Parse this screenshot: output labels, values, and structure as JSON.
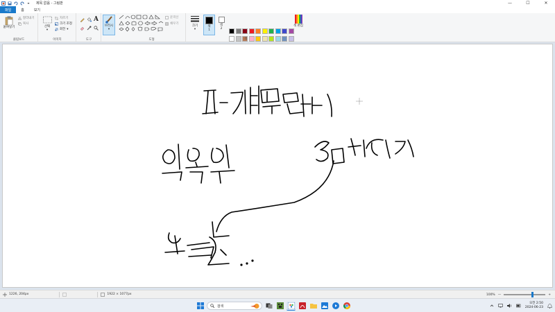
{
  "titlebar": {
    "title": "제목 없음 - 그림판",
    "minimize": "—",
    "maximize": "☐",
    "close": "✕"
  },
  "tabs": [
    {
      "label": "파일"
    },
    {
      "label": "홈"
    },
    {
      "label": "보기"
    }
  ],
  "ribbon": {
    "clipboard": {
      "paste": "붙여넣기",
      "cut": "잘라내기",
      "copy": "복사",
      "label": "클립보드"
    },
    "image": {
      "select": "선택",
      "crop": "자르기",
      "resize": "크기 조정",
      "rotate": "회전",
      "label": "이미지"
    },
    "tools": {
      "label": "도구"
    },
    "brushes": {
      "label": "브러시"
    },
    "shapes": {
      "outline": "윤곽선",
      "fill": "채우기",
      "label": "도형"
    },
    "size": {
      "label": "크기"
    },
    "color1": {
      "label": "색",
      "number": "1"
    },
    "color2": {
      "label": "색",
      "number": "2"
    },
    "edit_colors": {
      "label": "색 편집"
    },
    "colors_label": "색",
    "palette_row1": [
      "#000000",
      "#7f7f7f",
      "#880015",
      "#ed1c24",
      "#ff7f27",
      "#fff200",
      "#22b14c",
      "#00a2e8",
      "#3f48cc",
      "#a349a4"
    ],
    "palette_row2": [
      "#ffffff",
      "#c3c3c3",
      "#b97a57",
      "#ffaec9",
      "#ffc90e",
      "#efe4b0",
      "#b5e61d",
      "#99d9ea",
      "#7092be",
      "#c8bfe7"
    ],
    "palette_row3": [
      "#ffffff",
      "#ffffff",
      "#ffffff",
      "#ffffff",
      "#ffffff",
      "#ffffff",
      "#ffffff",
      "#ffffff",
      "#ffffff",
      "#ffffff"
    ]
  },
  "statusbar": {
    "cursor_pos": "1226, 204px",
    "dimensions": "1922 × 1077px",
    "zoom": "100%",
    "zoom_out": "—",
    "zoom_in": "+",
    "zoom_level": 0.7
  },
  "taskbar": {
    "search_placeholder": "검색",
    "time": "오전 2:50",
    "date": "2024-06-23"
  },
  "colors": {
    "file_tab": "#1979ca",
    "canvas_bg": "#dbe3ed"
  }
}
